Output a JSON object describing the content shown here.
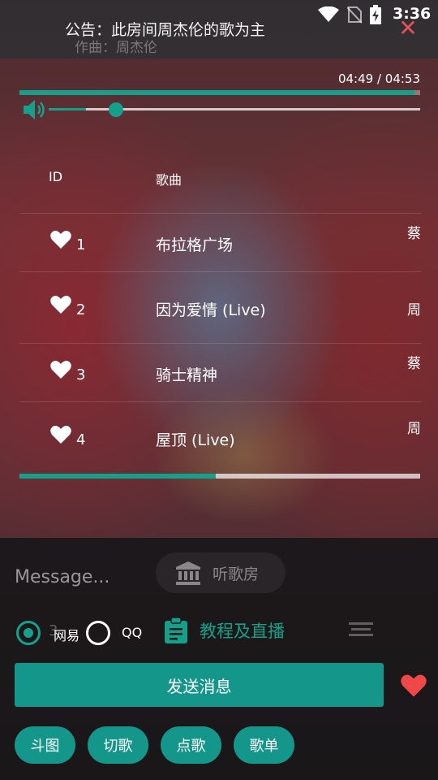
{
  "status_bar": {
    "time": "3:36"
  },
  "announcement": {
    "text": "公告：此房间周杰伦的歌为主"
  },
  "composer_ghost": "作曲：周杰伦",
  "player": {
    "time_display": "04:49 / 04:53",
    "progress": 0.986,
    "volume": 0.1
  },
  "playlist": {
    "headers": {
      "id": "ID",
      "song": "歌曲"
    },
    "rows": [
      {
        "id": "1",
        "song": "布拉格广场",
        "artist": "蔡"
      },
      {
        "id": "2",
        "song": "因为爱情 (Live)",
        "artist": "周"
      },
      {
        "id": "3",
        "song": "骑士精神",
        "artist": "蔡"
      },
      {
        "id": "4",
        "song": "屋顶 (Live)",
        "artist": "周"
      }
    ],
    "scroll_progress": 0.49
  },
  "composer": {
    "placeholder": "Message...",
    "room_label": "听歌房",
    "source_wy": "网易",
    "source_qq": "QQ",
    "ghost_count": "3",
    "tutorial_label": "教程及直播",
    "send_label": "发送消息"
  },
  "chips": [
    "斗图",
    "切歌",
    "点歌",
    "歌单"
  ],
  "colors": {
    "accent": "#14978a",
    "close": "#e4505c",
    "favorite": "#f04848"
  }
}
